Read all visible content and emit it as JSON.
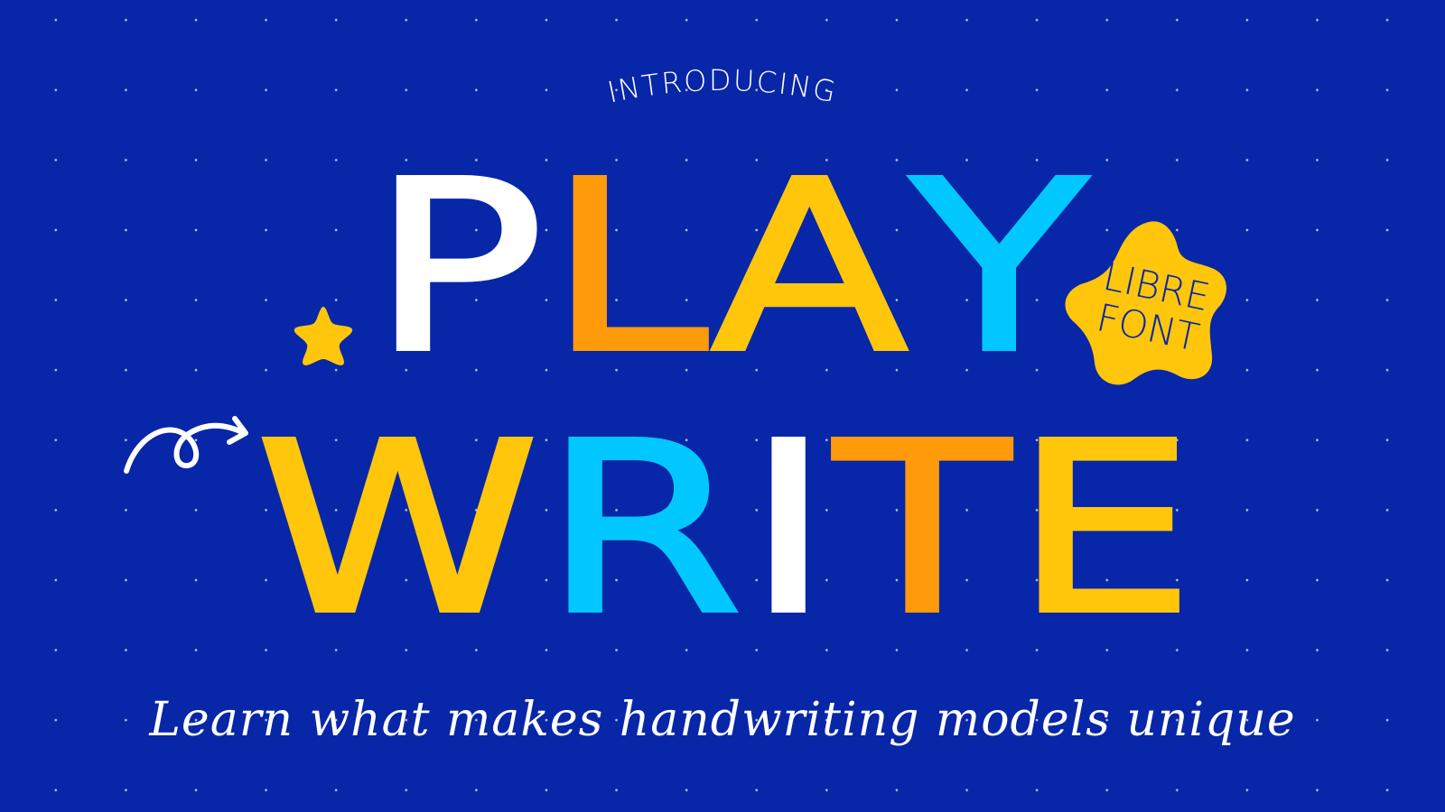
{
  "intro_label": "INTRODUCING",
  "title_line1": {
    "letters": [
      {
        "char": "P",
        "color": "#ffffff"
      },
      {
        "char": "L",
        "color": "#ff9a0a"
      },
      {
        "char": "A",
        "color": "#ffc60b"
      },
      {
        "char": "Y",
        "color": "#00c8ff"
      }
    ]
  },
  "title_line2": {
    "letters": [
      {
        "char": "W",
        "color": "#ffc60b"
      },
      {
        "char": "R",
        "color": "#00c8ff"
      },
      {
        "char": "I",
        "color": "#ffffff"
      },
      {
        "char": "T",
        "color": "#ff9a0a"
      },
      {
        "char": "E",
        "color": "#ffc60b"
      }
    ]
  },
  "badge": {
    "line1": "LIBRE",
    "line2": "FONT",
    "color": "#ffc60b",
    "text_color": "#0826a8"
  },
  "tagline": "Learn what makes handwriting models unique",
  "decorations": {
    "small_star_color": "#ffc60b",
    "arrow_color": "#ffffff",
    "background_color": "#0826a8"
  }
}
